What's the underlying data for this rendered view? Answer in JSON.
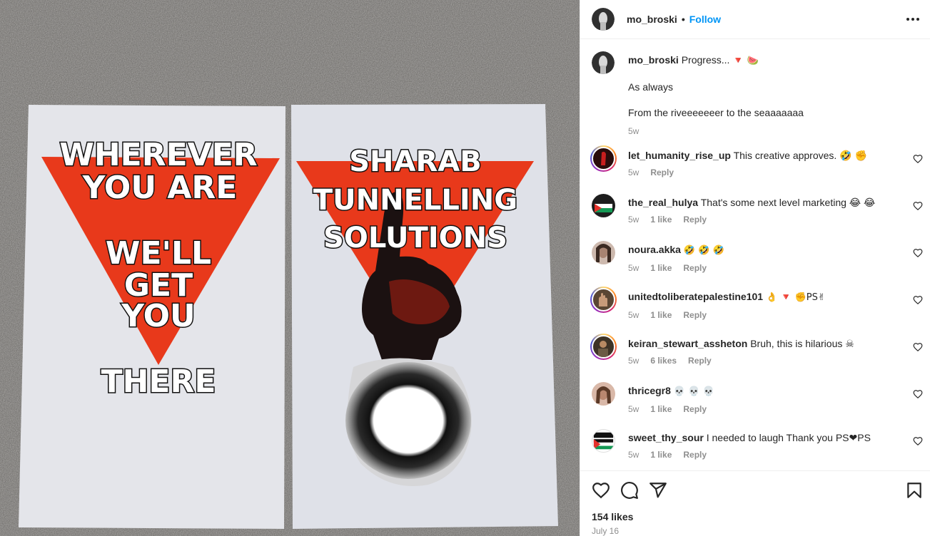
{
  "post": {
    "username": "mo_broski",
    "follow_label": "Follow",
    "separator": "•",
    "caption_text": "Progress...",
    "caption_emoji": "🔻 🍉",
    "caption_line2": "As always",
    "caption_line3": "From the riveeeeeeer to the seaaaaaaa",
    "caption_age": "5w",
    "likes": "154 likes",
    "date": "July 16"
  },
  "poster_left": {
    "line1": "WHEREVER",
    "line2": "YOU ARE",
    "line3": "WE'LL",
    "line4": "GET",
    "line5": "YOU",
    "line6": "THERE"
  },
  "poster_right": {
    "line1": "SHARAB",
    "line2": "TUNNELLING",
    "line3": "SOLUTIONS"
  },
  "comments": [
    {
      "user": "let_humanity_rise_up",
      "text": "This creative approves. 🤣 ✊",
      "age": "5w",
      "likes": "",
      "reply": "Reply",
      "ring": true,
      "avatar_color": "#2a0c0c"
    },
    {
      "user": "the_real_hulya",
      "text": "That's some next level marketing 😂 😂",
      "age": "5w",
      "likes": "1 like",
      "reply": "Reply",
      "ring": false,
      "avatar_color": "#1d1d1d"
    },
    {
      "user": "noura.akka",
      "text": "🤣 🤣 🤣",
      "age": "5w",
      "likes": "1 like",
      "reply": "Reply",
      "ring": false,
      "avatar_color": "#b59a8d"
    },
    {
      "user": "unitedtoliberatepalestine101",
      "text": "👌 🔻 ✊PS✌",
      "age": "5w",
      "likes": "1 like",
      "reply": "Reply",
      "ring": true,
      "avatar_color": "#5a4634"
    },
    {
      "user": "keiran_stewart_assheton",
      "text": "Bruh, this is hilarious ☠",
      "age": "5w",
      "likes": "6 likes",
      "reply": "Reply",
      "ring": true,
      "avatar_color": "#3e3326"
    },
    {
      "user": "thricegr8",
      "text": "💀 💀 💀",
      "age": "5w",
      "likes": "1 like",
      "reply": "Reply",
      "ring": false,
      "avatar_color": "#a27466"
    },
    {
      "user": "sweet_thy_sour",
      "text": "I needed to laugh Thank you PS❤PS",
      "age": "5w",
      "likes": "1 like",
      "reply": "Reply",
      "ring": false,
      "avatar_color": "#2c2c2c"
    }
  ],
  "icons": [
    "more-options-icon",
    "heart-icon",
    "comment-icon",
    "share-icon",
    "bookmark-icon"
  ],
  "colors": {
    "follow": "#0095f6",
    "poster_red": "#e53a1c",
    "muted": "#8e8e8e"
  }
}
